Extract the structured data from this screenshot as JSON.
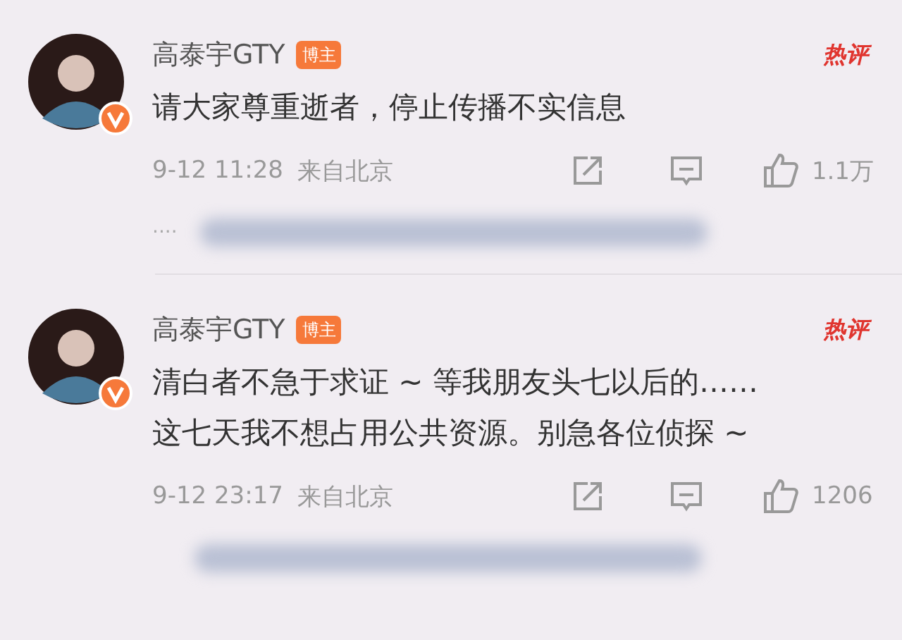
{
  "comments": [
    {
      "author": "高泰宇GTY",
      "verified": true,
      "badge": "博主",
      "hot_label": "热评",
      "text": "请大家尊重逝者，停止传播不实信息",
      "time": "9-12 11:28",
      "location": "来自北京",
      "likes": "1.1万",
      "replies_more": "····"
    },
    {
      "author": "高泰宇GTY",
      "verified": true,
      "badge": "博主",
      "hot_label": "热评",
      "text": "清白者不急于求证 ~ 等我朋友头七以后的…… 这七天我不想占用公共资源。别急各位侦探 ~",
      "time": "9-12 23:17",
      "location": "来自北京",
      "likes": "1206"
    }
  ]
}
